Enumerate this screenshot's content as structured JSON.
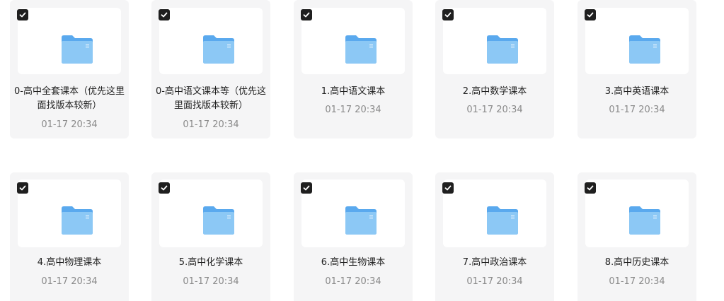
{
  "folders": [
    {
      "name": "0-高中全套课本（优先这里面找版本较新）",
      "time": "01-17 20:34",
      "checked": true
    },
    {
      "name": "0-高中语文课本等（优先这里面找版本较新）",
      "time": "01-17 20:34",
      "checked": true
    },
    {
      "name": "1.高中语文课本",
      "time": "01-17 20:34",
      "checked": true
    },
    {
      "name": "2.高中数学课本",
      "time": "01-17 20:34",
      "checked": true
    },
    {
      "name": "3.高中英语课本",
      "time": "01-17 20:34",
      "checked": true
    },
    {
      "name": "4.高中物理课本",
      "time": "01-17 20:34",
      "checked": true
    },
    {
      "name": "5.高中化学课本",
      "time": "01-17 20:34",
      "checked": true
    },
    {
      "name": "6.高中生物课本",
      "time": "01-17 20:34",
      "checked": true
    },
    {
      "name": "7.高中政治课本",
      "time": "01-17 20:34",
      "checked": true
    },
    {
      "name": "8.高中历史课本",
      "time": "01-17 20:34",
      "checked": true
    }
  ],
  "colors": {
    "card_bg": "#f5f5f6",
    "folder_front": "#8cc8f5",
    "folder_back": "#5aa9ee",
    "checkbox": "#1f1f1f"
  },
  "icons": {
    "checkbox": "check-icon",
    "folder": "folder-icon"
  }
}
